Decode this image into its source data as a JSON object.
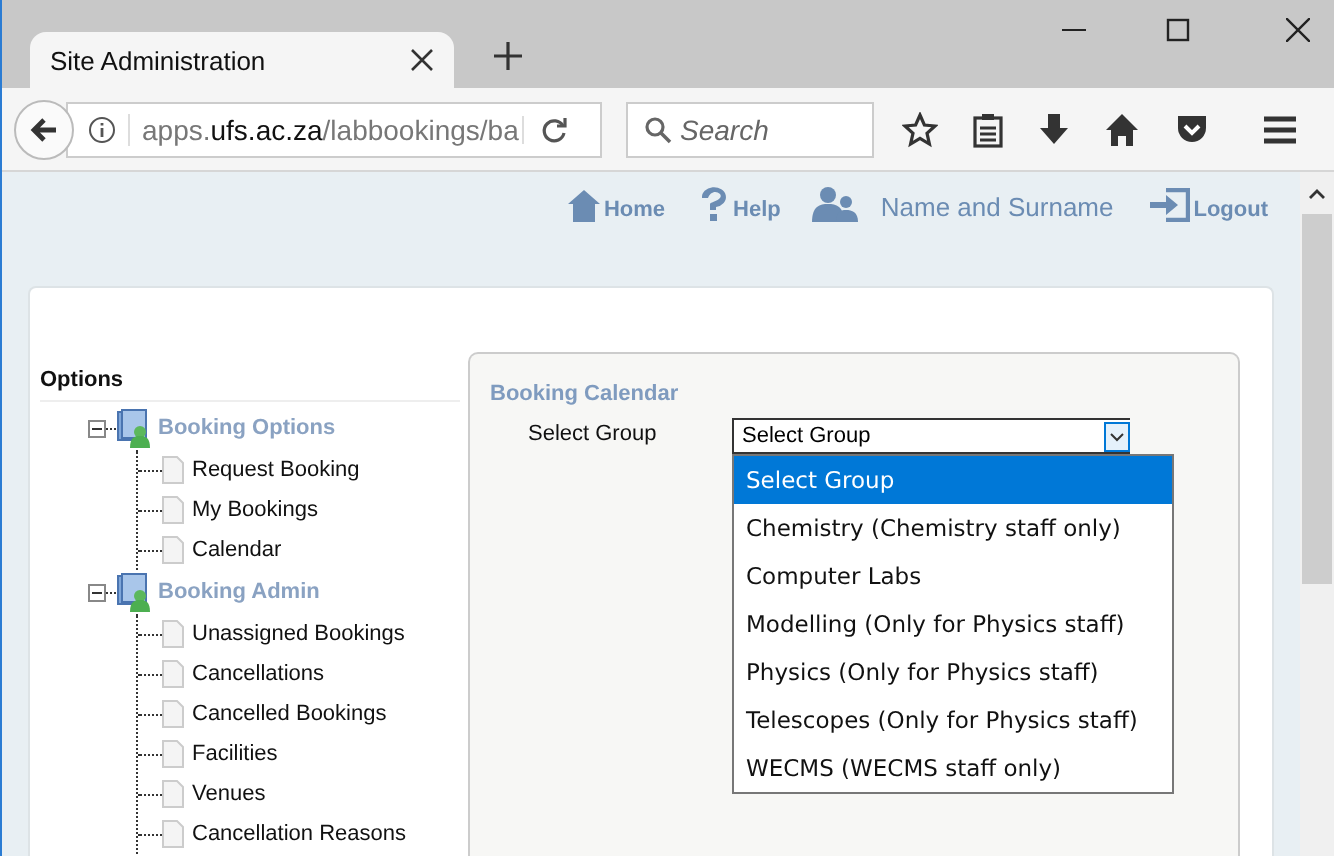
{
  "window": {
    "tab_title": "Site Administration"
  },
  "toolbar": {
    "url": {
      "prefix": "apps.",
      "domain": "ufs.ac.za",
      "path": "/labbookings/ba"
    },
    "search": {
      "placeholder": "Search"
    }
  },
  "nav": [
    {
      "kind": "home",
      "label": "Home"
    },
    {
      "kind": "help",
      "label": "Help"
    },
    {
      "kind": "user",
      "label": "Name and Surname"
    },
    {
      "kind": "logout",
      "label": "Logout"
    }
  ],
  "sidebar": {
    "title": "Options",
    "tree": [
      {
        "label": "Booking Options",
        "expanded": true,
        "children": [
          {
            "label": "Request Booking"
          },
          {
            "label": "My Bookings"
          },
          {
            "label": "Calendar"
          }
        ]
      },
      {
        "label": "Booking Admin",
        "expanded": true,
        "children": [
          {
            "label": "Unassigned Bookings"
          },
          {
            "label": "Cancellations"
          },
          {
            "label": "Cancelled Bookings"
          },
          {
            "label": "Facilities"
          },
          {
            "label": "Venues"
          },
          {
            "label": "Cancellation Reasons"
          }
        ]
      }
    ]
  },
  "panel": {
    "title": "Booking Calendar",
    "field_label": "Select Group",
    "select": {
      "value": "Select Group",
      "expanded": true,
      "options": [
        {
          "label": "Select Group",
          "selected": true
        },
        {
          "label": "Chemistry (Chemistry staff only)",
          "selected": false
        },
        {
          "label": "Computer Labs",
          "selected": false
        },
        {
          "label": "Modelling (Only for Physics staff)",
          "selected": false
        },
        {
          "label": "Physics (Only for Physics staff)",
          "selected": false
        },
        {
          "label": "Telescopes (Only for Physics staff)",
          "selected": false
        },
        {
          "label": "WECMS (WECMS staff only)",
          "selected": false
        }
      ]
    }
  }
}
